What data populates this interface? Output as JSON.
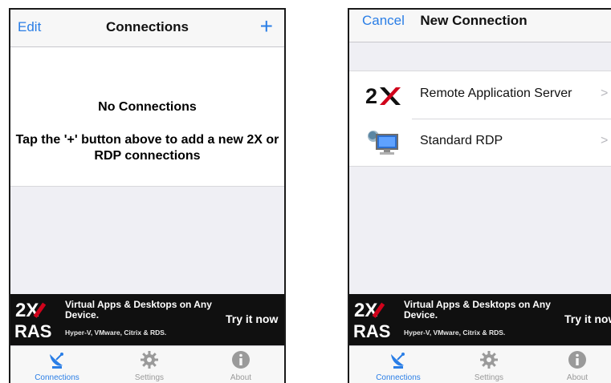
{
  "colors": {
    "accent": "#2a7ee6",
    "tab_inactive": "#9a9a9a",
    "ad_background": "#101010",
    "background": "#efeff4"
  },
  "left_screen": {
    "navbar": {
      "edit_label": "Edit",
      "title": "Connections",
      "add_label": "+",
      "add_icon": "plus-icon"
    },
    "empty_state": {
      "title": "No Connections",
      "message": "Tap the '+' button above to add a new 2X or RDP connections"
    }
  },
  "right_screen": {
    "navbar": {
      "cancel_label": "Cancel",
      "title": "New Connection"
    },
    "connection_types": [
      {
        "label": "Remote Application Server",
        "icon": "2x-logo-icon"
      },
      {
        "label": "Standard RDP",
        "icon": "rdp-computer-icon"
      }
    ],
    "chevron": ">"
  },
  "ad": {
    "logo_top": "2X",
    "logo_bottom": "RAS",
    "headline": "Virtual Apps & Desktops on Any Device.",
    "subline": "Hyper-V, VMware, Citrix & RDS.",
    "cta": "Try it now"
  },
  "tabs": [
    {
      "label": "Connections",
      "icon": "satellite-dish-icon",
      "active": true
    },
    {
      "label": "Settings",
      "icon": "gear-icon",
      "active": false
    },
    {
      "label": "About",
      "icon": "info-icon",
      "active": false
    }
  ]
}
